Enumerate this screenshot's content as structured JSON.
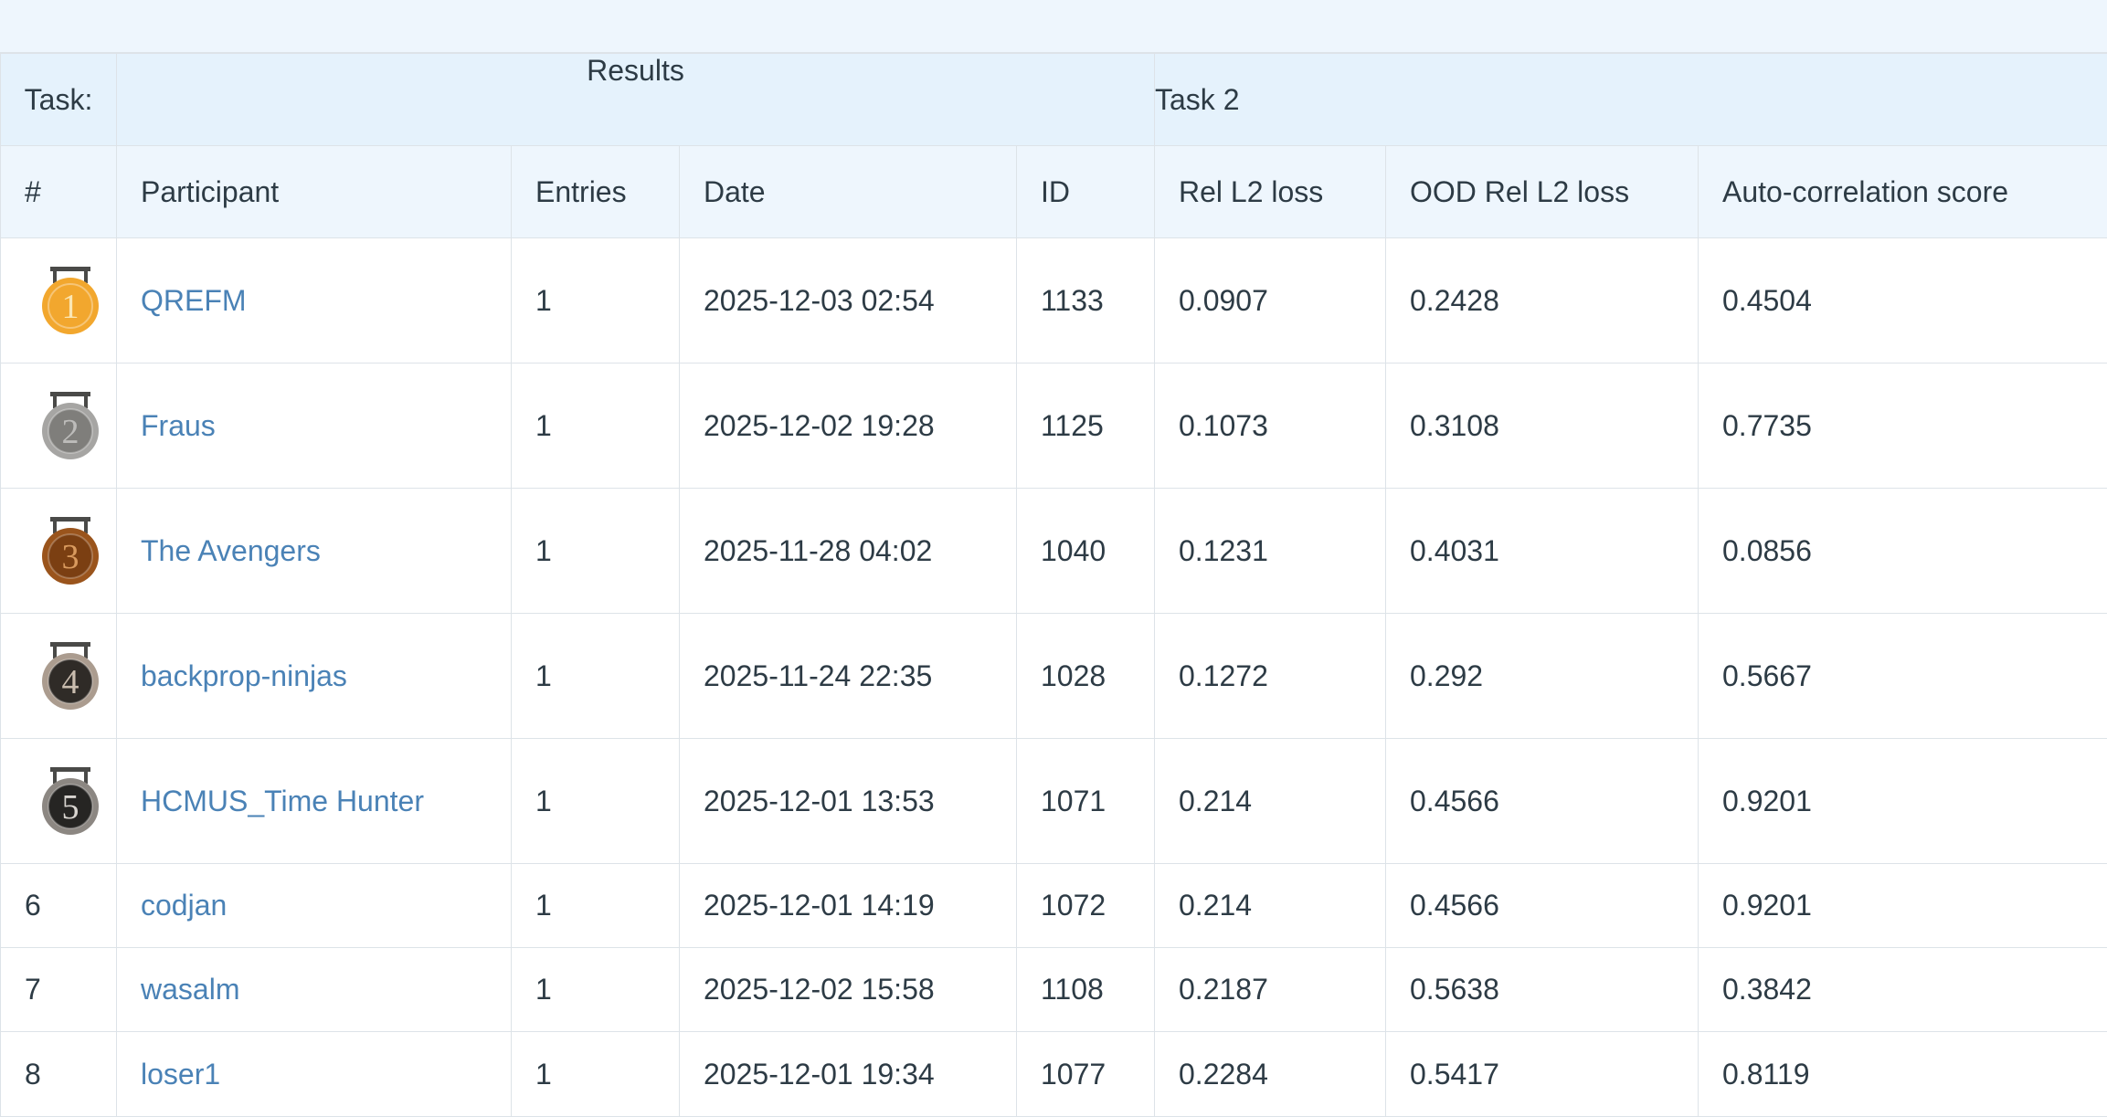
{
  "header": {
    "task_label": "Task:",
    "results_label": "Results",
    "task_name": "Task 2"
  },
  "columns": [
    "#",
    "Participant",
    "Entries",
    "Date",
    "ID",
    "Rel L2 loss",
    "OOD Rel L2 loss",
    "Auto-correlation score"
  ],
  "medal_colors": {
    "1": "#f2a72e",
    "2": "#a6a5a3",
    "3": "#9a541c",
    "4": "#ab9c8f",
    "5": "#8c8782"
  },
  "rows": [
    {
      "rank": "1",
      "participant": "QREFM",
      "entries": "1",
      "date": "2025-12-03 02:54",
      "id": "1133",
      "rel_l2": "0.0907",
      "ood_rel_l2": "0.2428",
      "autocorr": "0.4504"
    },
    {
      "rank": "2",
      "participant": "Fraus",
      "entries": "1",
      "date": "2025-12-02 19:28",
      "id": "1125",
      "rel_l2": "0.1073",
      "ood_rel_l2": "0.3108",
      "autocorr": "0.7735"
    },
    {
      "rank": "3",
      "participant": "The Avengers",
      "entries": "1",
      "date": "2025-11-28 04:02",
      "id": "1040",
      "rel_l2": "0.1231",
      "ood_rel_l2": "0.4031",
      "autocorr": "0.0856"
    },
    {
      "rank": "4",
      "participant": "backprop-ninjas",
      "entries": "1",
      "date": "2025-11-24 22:35",
      "id": "1028",
      "rel_l2": "0.1272",
      "ood_rel_l2": "0.292",
      "autocorr": "0.5667"
    },
    {
      "rank": "5",
      "participant": "HCMUS_Time Hunter",
      "entries": "1",
      "date": "2025-12-01 13:53",
      "id": "1071",
      "rel_l2": "0.214",
      "ood_rel_l2": "0.4566",
      "autocorr": "0.9201"
    },
    {
      "rank": "6",
      "participant": "codjan",
      "entries": "1",
      "date": "2025-12-01 14:19",
      "id": "1072",
      "rel_l2": "0.214",
      "ood_rel_l2": "0.4566",
      "autocorr": "0.9201"
    },
    {
      "rank": "7",
      "participant": "wasalm",
      "entries": "1",
      "date": "2025-12-02 15:58",
      "id": "1108",
      "rel_l2": "0.2187",
      "ood_rel_l2": "0.5638",
      "autocorr": "0.3842"
    },
    {
      "rank": "8",
      "participant": "loser1",
      "entries": "1",
      "date": "2025-12-01 19:34",
      "id": "1077",
      "rel_l2": "0.2284",
      "ood_rel_l2": "0.5417",
      "autocorr": "0.8119"
    }
  ]
}
